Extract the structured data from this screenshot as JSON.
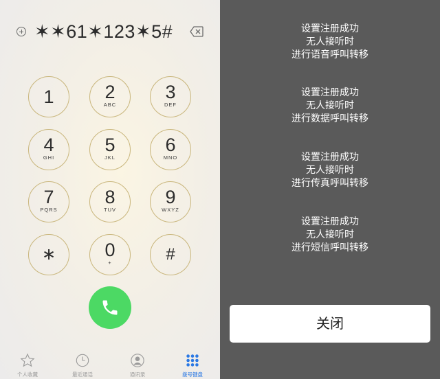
{
  "dialer": {
    "number": "✶✶61✶123✶5#",
    "keys": [
      {
        "digit": "1",
        "letters": ""
      },
      {
        "digit": "2",
        "letters": "ABC"
      },
      {
        "digit": "3",
        "letters": "DEF"
      },
      {
        "digit": "4",
        "letters": "GHI"
      },
      {
        "digit": "5",
        "letters": "JKL"
      },
      {
        "digit": "6",
        "letters": "MNO"
      },
      {
        "digit": "7",
        "letters": "PQRS"
      },
      {
        "digit": "8",
        "letters": "TUV"
      },
      {
        "digit": "9",
        "letters": "WXYZ"
      },
      {
        "digit": "∗",
        "letters": ""
      },
      {
        "digit": "0",
        "letters": "+"
      },
      {
        "digit": "#",
        "letters": ""
      }
    ],
    "tabs": [
      {
        "label": "个人收藏",
        "icon": "star-icon"
      },
      {
        "label": "最近通话",
        "icon": "clock-icon"
      },
      {
        "label": "通讯录",
        "icon": "contacts-icon"
      },
      {
        "label": "拨号键盘",
        "icon": "keypad-icon",
        "active": true
      }
    ],
    "colors": {
      "ring": "#c9b67c",
      "call": "#4cd964",
      "active_tab": "#2a78e4"
    }
  },
  "result": {
    "messages": [
      {
        "line1": "设置注册成功",
        "line2": "无人接听时",
        "line3": "进行语音呼叫转移"
      },
      {
        "line1": "设置注册成功",
        "line2": "无人接听时",
        "line3": "进行数据呼叫转移"
      },
      {
        "line1": "设置注册成功",
        "line2": "无人接听时",
        "line3": "进行传真呼叫转移"
      },
      {
        "line1": "设置注册成功",
        "line2": "无人接听时",
        "line3": "进行短信呼叫转移"
      }
    ],
    "close_label": "关闭",
    "colors": {
      "background": "#5a5a5a"
    }
  }
}
